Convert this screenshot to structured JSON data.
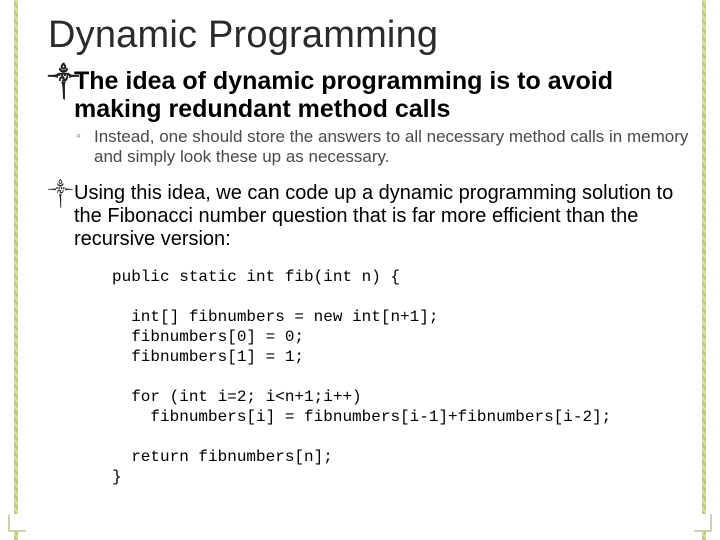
{
  "title": "Dynamic Programming",
  "bullet1": {
    "marker": "༒",
    "lead": "The",
    "rest": " idea of dynamic programming is to avoid making redundant method calls"
  },
  "sub1": {
    "marker": "◦",
    "text": "Instead, one should store the answers to all necessary method calls in memory and simply look these up as necessary."
  },
  "bullet2": {
    "marker": "༒",
    "lead": "Using",
    "rest": " this idea, we can code up a dynamic programming solution to the Fibonacci number question that is far more efficient than the recursive version:"
  },
  "code": "public static int fib(int n) {\n\n  int[] fibnumbers = new int[n+1];\n  fibnumbers[0] = 0;\n  fibnumbers[1] = 1;\n\n  for (int i=2; i<n+1;i++)\n    fibnumbers[i] = fibnumbers[i-1]+fibnumbers[i-2];\n\n  return fibnumbers[n];\n}"
}
